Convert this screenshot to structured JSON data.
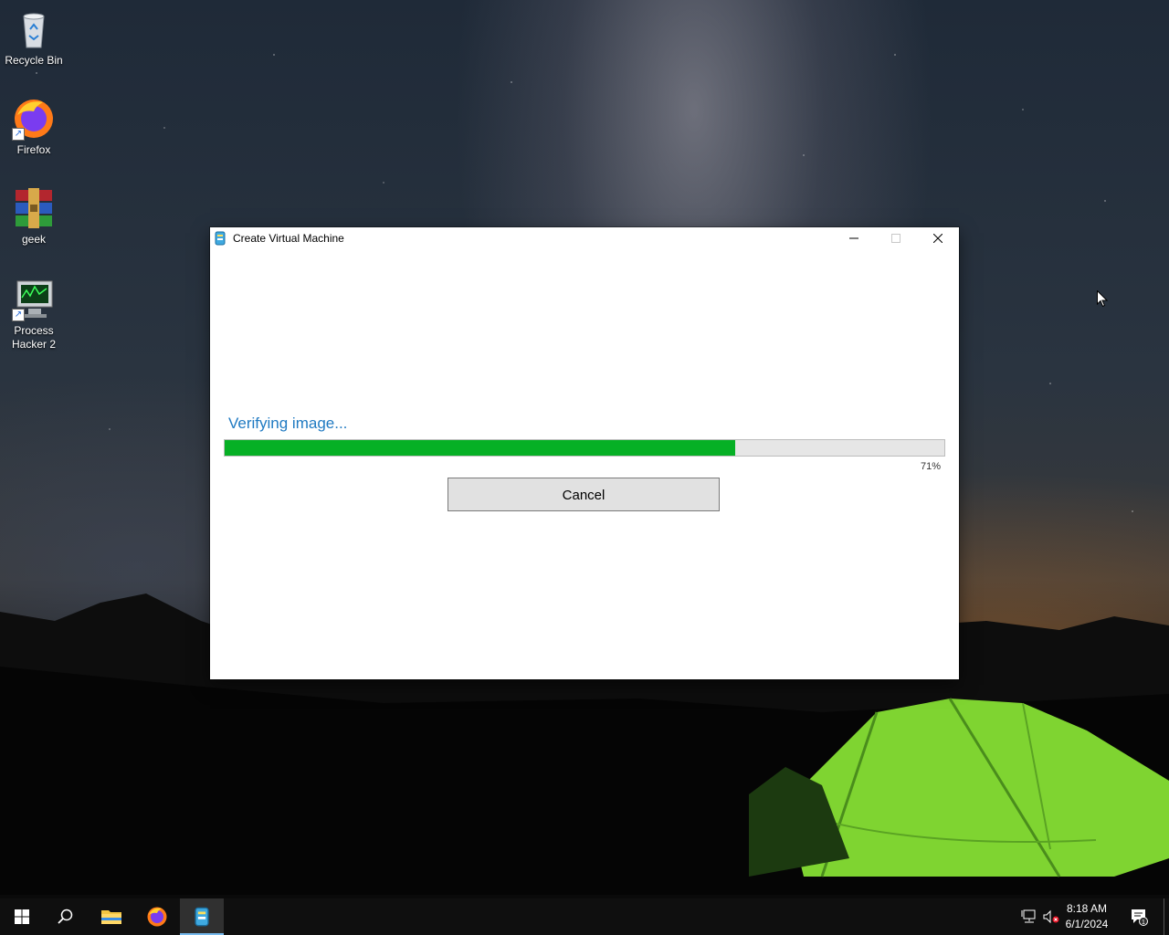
{
  "desktop": {
    "icons": [
      {
        "label": "Recycle Bin",
        "icon": "recycle-bin-icon"
      },
      {
        "label": "Firefox",
        "icon": "firefox-icon"
      },
      {
        "label": "geek",
        "icon": "winrar-icon"
      },
      {
        "label": "Process Hacker 2",
        "icon": "process-hacker-icon"
      }
    ]
  },
  "window": {
    "title": "Create Virtual Machine",
    "status_text": "Verifying image...",
    "progress": 0.71,
    "progress_label": "71%",
    "cancel_label": "Cancel",
    "colors": {
      "status_text": "#1f7ac2",
      "progress_fill": "#06b025"
    }
  },
  "taskbar": {
    "items": [
      {
        "icon": "windows-start-icon"
      },
      {
        "icon": "search-icon"
      },
      {
        "icon": "file-explorer-icon"
      },
      {
        "icon": "firefox-icon"
      },
      {
        "icon": "virtual-machine-app-icon",
        "active": true
      }
    ],
    "clock": {
      "time": "8:18 AM",
      "date": "6/1/2024"
    },
    "notification_count": "1"
  }
}
